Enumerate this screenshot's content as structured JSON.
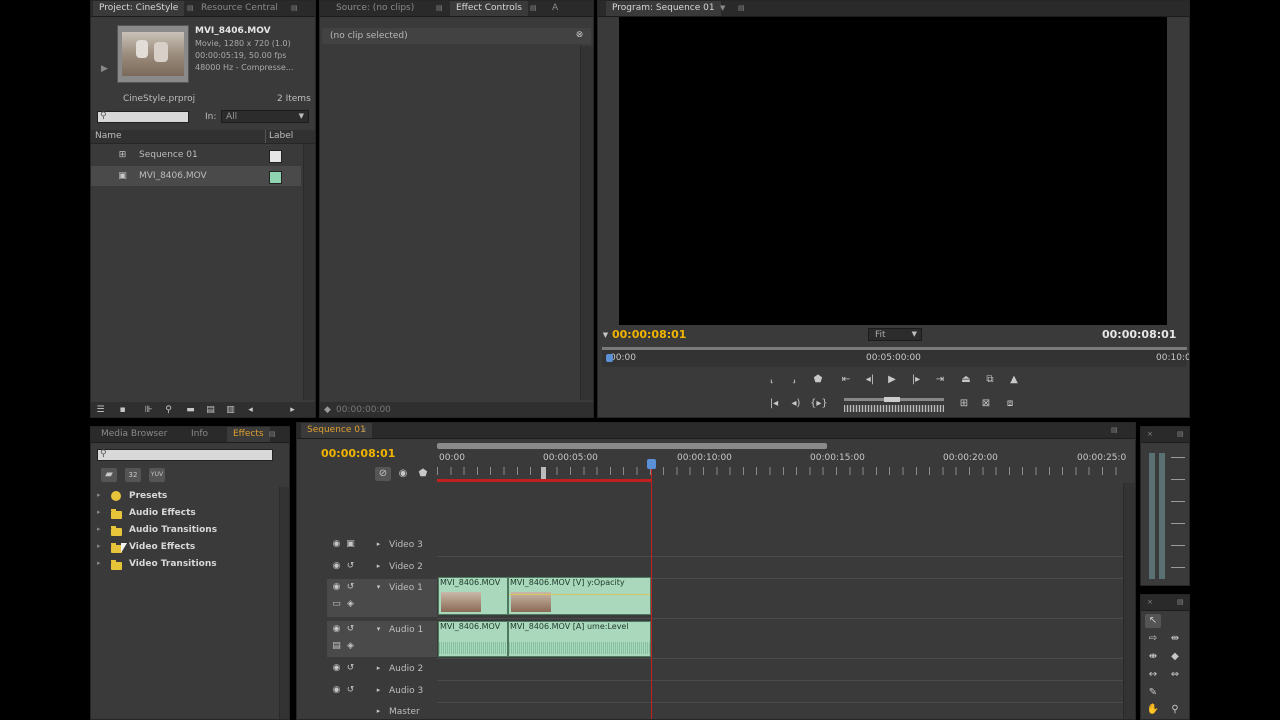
{
  "project": {
    "tabs": [
      "Project: CineStyle",
      "Resource Central"
    ],
    "clip_name": "MVI_8406.MOV",
    "clip_info": [
      "Movie, 1280 x 720 (1.0)",
      "00:00:05:19, 50.00 fps",
      "48000 Hz - Compresse..."
    ],
    "project_file": "CineStyle.prproj",
    "item_count": "2 Items",
    "in_label": "In:",
    "in_value": "All",
    "col_name": "Name",
    "col_label": "Label",
    "items": [
      {
        "name": "Sequence 01",
        "label_color": "#e6e6e6"
      },
      {
        "name": "MVI_8406.MOV",
        "label_color": "#8fd3b0"
      }
    ]
  },
  "effect_controls": {
    "tabs": [
      "Source: (no clips)",
      "Effect Controls",
      "A"
    ],
    "status": "(no clip selected)",
    "timecode": "00:00:00:00"
  },
  "program": {
    "tab": "Program: Sequence 01",
    "current_tc": "00:00:08:01",
    "duration_tc": "00:00:08:01",
    "fit": "Fit",
    "ruler": [
      "00:00",
      "00:05:00:00",
      "00:10:0"
    ]
  },
  "effects": {
    "tabs": [
      "Media Browser",
      "Info",
      "Effects"
    ],
    "folders": [
      "Presets",
      "Audio Effects",
      "Audio Transitions",
      "Video Effects",
      "Video Transitions"
    ]
  },
  "timeline": {
    "tab": "Sequence 01",
    "timecode": "00:00:08:01",
    "ruler": [
      "00:00",
      "00:00:05:00",
      "00:00:10:00",
      "00:00:15:00",
      "00:00:20:00",
      "00:00:25:0"
    ],
    "tracks": [
      "Video 3",
      "Video 2",
      "Video 1",
      "Audio 1",
      "Audio 2",
      "Audio 3",
      "Master"
    ],
    "v1_clips": [
      "MVI_8406.MOV",
      "MVI_8406.MOV [V]  y:Opacity"
    ],
    "a1_clips": [
      "MVI_8406.MOV",
      "MVI_8406.MOV [A]  ume:Level"
    ]
  },
  "colors": {
    "accent_timecode": "#f0b400",
    "playhead": "#c02020",
    "clip_fill": "#a9d8bd"
  }
}
